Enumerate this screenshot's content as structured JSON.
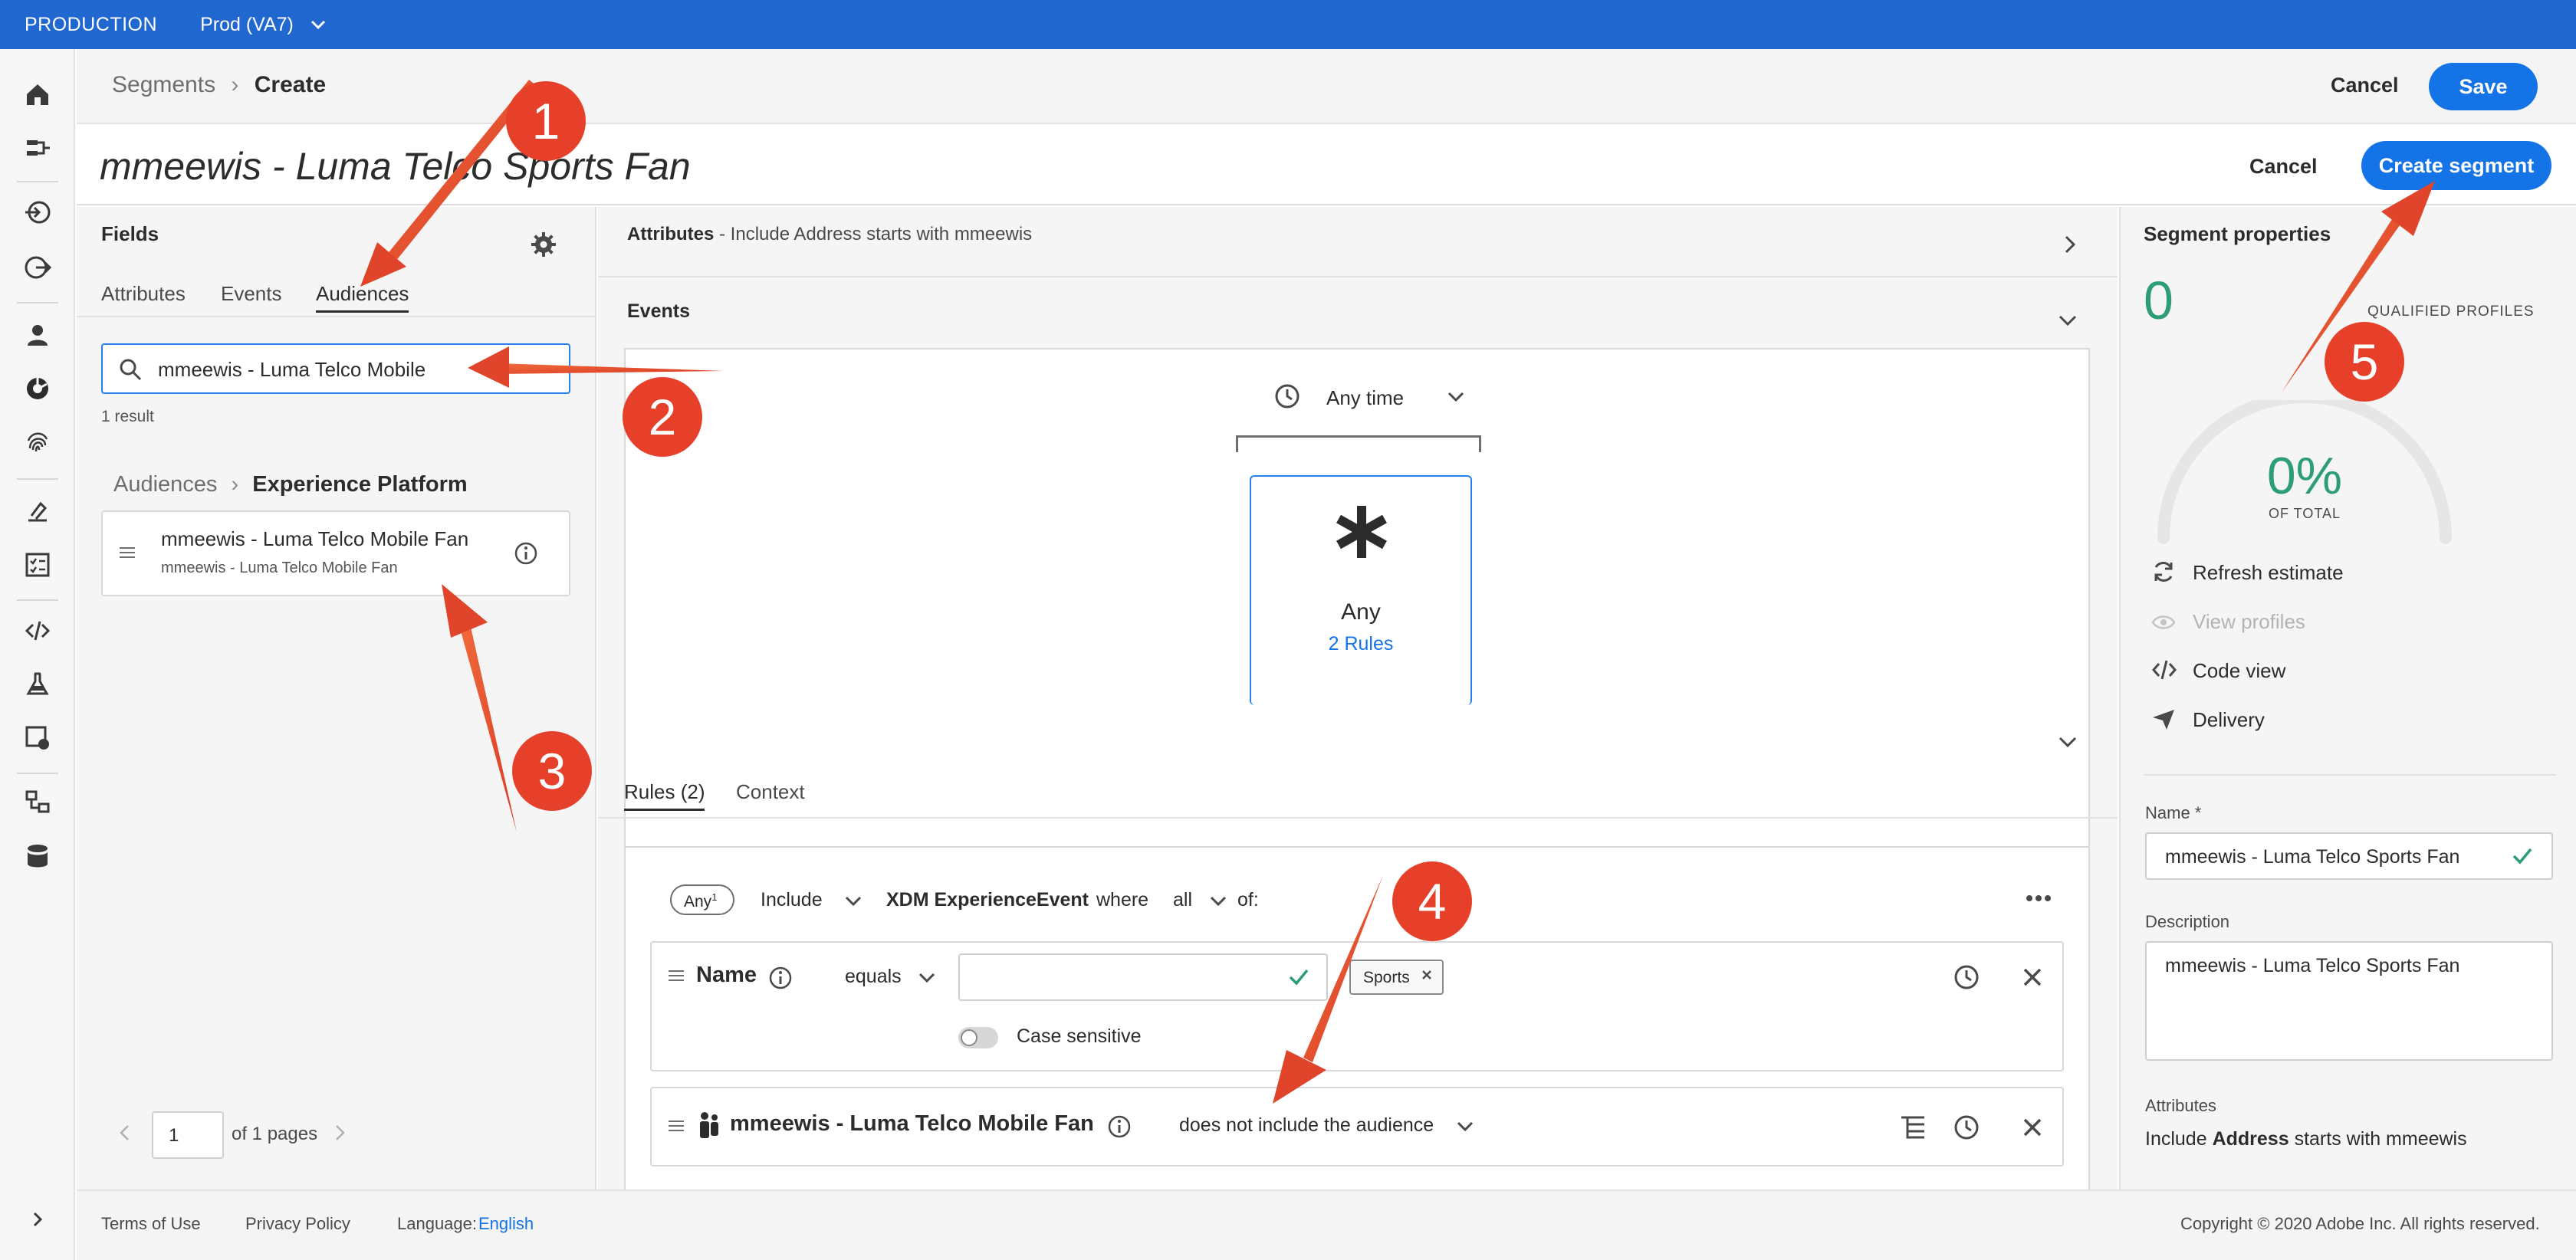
{
  "topbar": {
    "environment": "PRODUCTION",
    "sandbox": "Prod (VA7)"
  },
  "breadcrumb": {
    "parent": "Segments",
    "current": "Create"
  },
  "header_actions": {
    "cancel": "Cancel",
    "save": "Save"
  },
  "segment": {
    "title": "mmeewis - Luma Telco Sports Fan",
    "cancel": "Cancel",
    "create": "Create segment"
  },
  "fields_panel": {
    "title": "Fields",
    "tabs": [
      "Attributes",
      "Events",
      "Audiences"
    ],
    "search_value": "mmeewis - Luma Telco Mobile",
    "result_count": "1 result",
    "crumb_parent": "Audiences",
    "crumb_current": "Experience Platform",
    "item_title": "mmeewis - Luma Telco Mobile Fan",
    "item_subtitle": "mmeewis - Luma Telco Mobile Fan",
    "page_value": "1",
    "page_of": "of 1 pages"
  },
  "canvas": {
    "attributes_label": "Attributes",
    "attributes_summary": "- Include Address starts with mmeewis",
    "events_label": "Events",
    "time_filter": "Any time",
    "card_title": "Any",
    "card_rules": "2 Rules",
    "tabs": [
      "Rules (2)",
      "Context"
    ],
    "rule_header": {
      "badge": "Any",
      "badge_sup": "1",
      "include": "Include",
      "schema": "XDM ExperienceEvent",
      "where": "where",
      "all": "all",
      "of": "of:"
    },
    "rule1": {
      "field": "Name",
      "operator": "equals",
      "chip": "Sports",
      "case_label": "Case sensitive"
    },
    "rule2": {
      "field": "mmeewis - Luma Telco Mobile Fan",
      "operator": "does not include the audience"
    }
  },
  "properties": {
    "title": "Segment properties",
    "count": "0",
    "qualified_label": "QUALIFIED PROFILES",
    "percent": "0%",
    "of_total": "OF TOTAL",
    "actions": [
      "Refresh estimate",
      "View profiles",
      "Code view",
      "Delivery"
    ],
    "name_label": "Name *",
    "name_value": "mmeewis - Luma Telco Sports Fan",
    "desc_label": "Description",
    "desc_value": "mmeewis - Luma Telco Sports Fan",
    "attr_label": "Attributes",
    "attr_prefix": "Include",
    "attr_bold": "Address",
    "attr_suffix": "starts with mmeewis"
  },
  "footer": {
    "terms": "Terms of Use",
    "privacy": "Privacy Policy",
    "language_label": "Language:",
    "language_value": "English",
    "copyright": "Copyright © 2020 Adobe Inc. All rights reserved."
  },
  "callouts": [
    "1",
    "2",
    "3",
    "4",
    "5"
  ],
  "colors": {
    "brand": "#2068d0",
    "cta": "#1473e6",
    "callout": "#e7402a",
    "positive": "#2d9d78"
  }
}
